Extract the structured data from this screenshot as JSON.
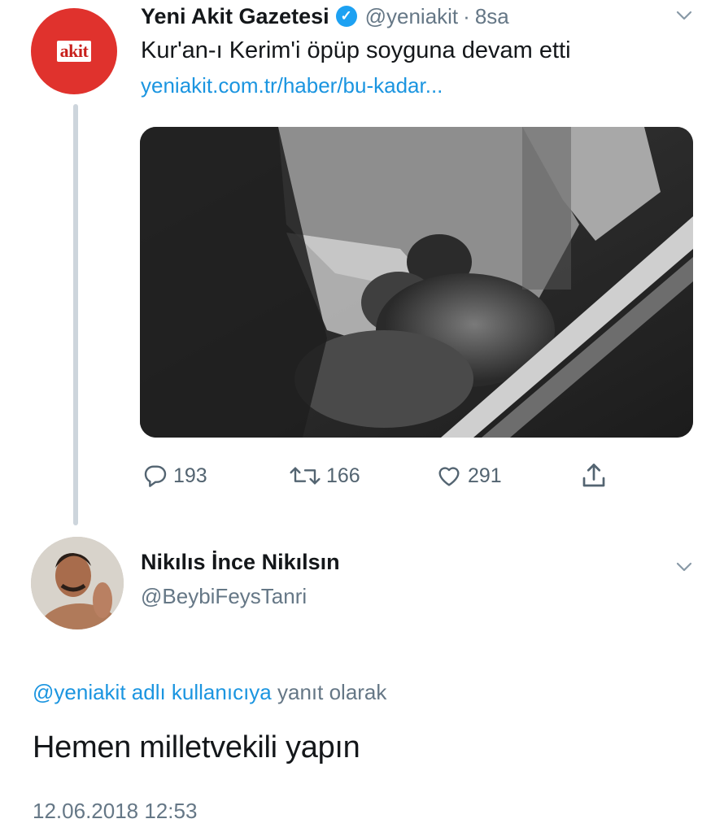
{
  "original_tweet": {
    "avatar_logo_text": "akit",
    "display_name": "Yeni Akit Gazetesi",
    "verified": true,
    "handle": "@yeniakit",
    "separator": "·",
    "time_ago": "8sa",
    "text": "Kur'an-ı Kerim'i öpüp soyguna devam etti",
    "link_text": "yeniakit.com.tr/haber/bu-kadar...",
    "media_description": "security camera still image",
    "actions": {
      "replies": "193",
      "retweets": "166",
      "likes": "291"
    },
    "icons": {
      "reply": "reply-icon",
      "retweet": "retweet-icon",
      "like": "heart-icon",
      "share": "share-icon",
      "menu": "chevron-down-icon",
      "verified": "verified-badge-icon"
    }
  },
  "reply_tweet": {
    "display_name": "Nikılıs İnce Nikılsın",
    "handle": "@BeybiFeysTanri",
    "replying_mention": "@yeniakit adlı kullanıcıya",
    "replying_suffix": " yanıt olarak",
    "text": "Hemen milletvekili yapın",
    "timestamp": "12.06.2018 12:53"
  },
  "colors": {
    "link_blue": "#1b95e0",
    "muted_gray": "#657786",
    "avatar_red": "#e0322d",
    "verified_blue": "#1da1f2",
    "thread_line": "#cdd5dc"
  }
}
